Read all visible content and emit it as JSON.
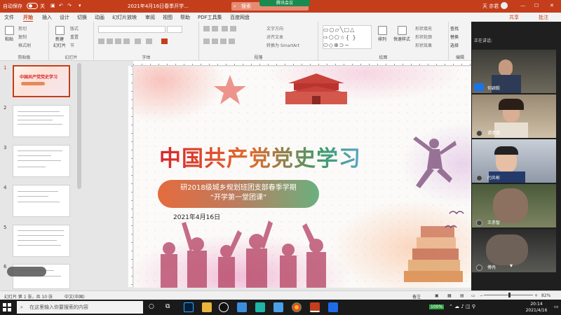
{
  "titlebar": {
    "autosave_label": "自动保存",
    "autosave_state": "关",
    "doc_title": "2021年4月16日春季开学...",
    "search_placeholder": "搜索",
    "meeting_badge": "腾讯会议",
    "user_name": "天 亦君"
  },
  "tabs": [
    "文件",
    "开始",
    "插入",
    "设计",
    "切换",
    "动画",
    "幻灯片放映",
    "审阅",
    "视图",
    "帮助",
    "PDF工具集",
    "百度网盘"
  ],
  "right_menu": {
    "share": "共享",
    "comment": "批注"
  },
  "ribbon": {
    "clipboard": {
      "paste": "粘贴",
      "cut": "剪切",
      "copy": "复制",
      "format_painter": "格式刷",
      "label": "剪贴板"
    },
    "slides": {
      "new_slide": "新建\n幻灯片",
      "layout": "版式",
      "reset": "重置",
      "section": "节",
      "label": "幻灯片"
    },
    "font": {
      "label": "字体"
    },
    "paragraph": {
      "text_direction": "文字方向",
      "align_text": "对齐文本",
      "smartart": "转换为 SmartArt",
      "label": "段落"
    },
    "drawing": {
      "arrange": "排列",
      "quick_styles": "快速样式",
      "fill": "形状填充",
      "outline": "形状轮廓",
      "effects": "形状效果",
      "label": "绘图"
    },
    "editing": {
      "find": "查找",
      "replace": "替换",
      "select": "选择",
      "label": "编辑"
    }
  },
  "slides_panel": {
    "numbers": [
      "1",
      "2",
      "3",
      "4",
      "5",
      "6"
    ],
    "thumb1_title": "中国共产党党史学习"
  },
  "slide": {
    "title": "中国共产党党史学习",
    "subtitle_line1": "研2018级城乡规划班团支部春季学期",
    "subtitle_line2": "“开学第一堂团课”",
    "date": "2021年4月16日"
  },
  "video_panel": {
    "speaking_label": "正在讲话:",
    "participants": [
      "何颖毅",
      "谭倩倩",
      "闫炎彬",
      "王赤智",
      "傅冉"
    ]
  },
  "statusbar": {
    "slide_info": "幻灯片 第 1 张，共 10 张",
    "language": "中文(中国)",
    "notes": "备注",
    "zoom": "82%"
  },
  "taskbar": {
    "search_placeholder": "在这里输入你要搜索的内容",
    "time": "20:14",
    "date": "2021/4/16",
    "battery": "100%"
  },
  "colors": {
    "accent": "#c43e1c",
    "title_start": "#d9242b",
    "title_end": "#3c9a6a"
  }
}
